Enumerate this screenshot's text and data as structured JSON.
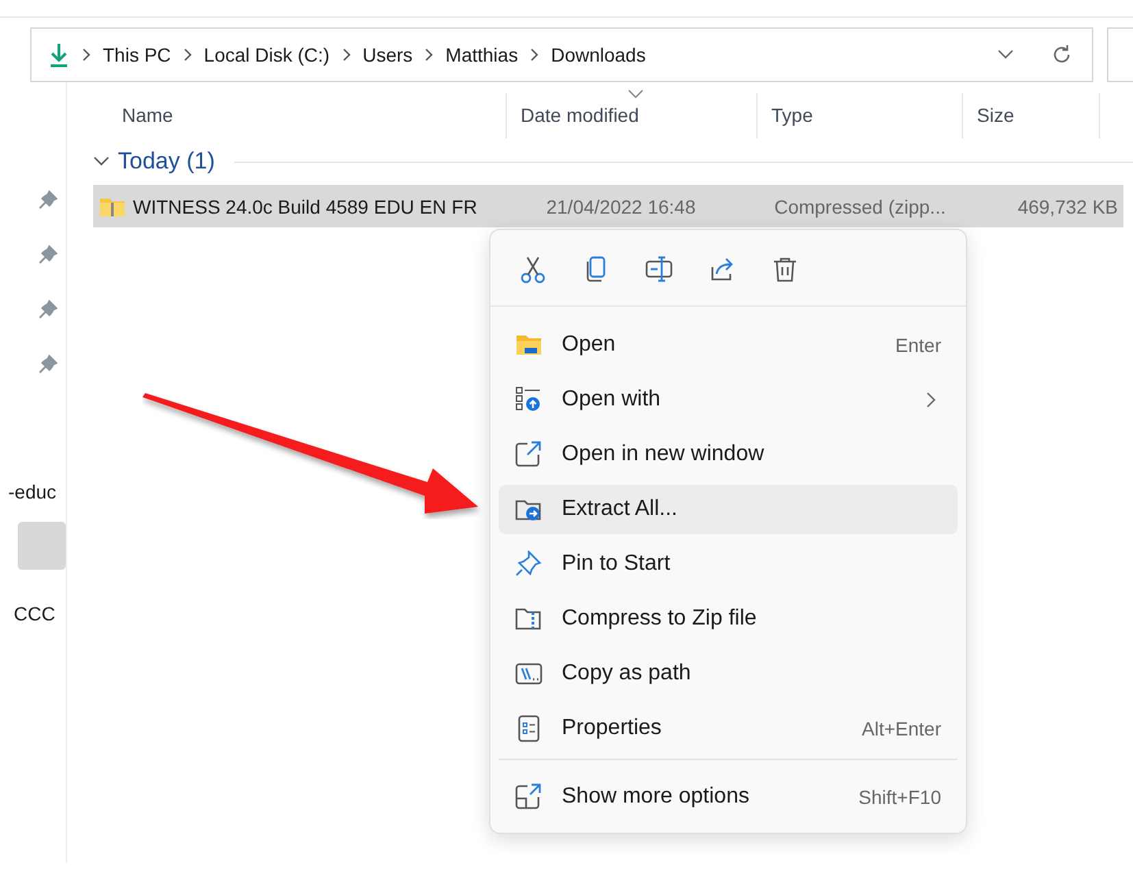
{
  "breadcrumb": [
    "This PC",
    "Local Disk (C:)",
    "Users",
    "Matthias",
    "Downloads"
  ],
  "columns": [
    {
      "label": "Name",
      "sorted": false
    },
    {
      "label": "Date modified",
      "sorted": true
    },
    {
      "label": "Type",
      "sorted": false
    },
    {
      "label": "Size",
      "sorted": false
    }
  ],
  "group": {
    "label": "Today (1)",
    "expanded": true
  },
  "rows": [
    {
      "name": "WITNESS 24.0c Build 4589 EDU EN FR",
      "date": "21/04/2022 16:48",
      "type": "Compressed (zipp...",
      "size": "469,732 KB",
      "selected": true
    }
  ],
  "nav_items": [
    {
      "label": "-educ",
      "selected": false
    },
    {
      "selected": true
    },
    {
      "label": "CCC",
      "selected": false
    }
  ],
  "context_menu": {
    "sections": [
      [
        {
          "label": "Open",
          "shortcut": "Enter",
          "submenu": false,
          "selected": false
        },
        {
          "label": "Open with",
          "submenu": true,
          "selected": false
        },
        {
          "label": "Open in new window",
          "submenu": false,
          "selected": false
        },
        {
          "label": "Extract All...",
          "submenu": false,
          "selected": true
        },
        {
          "label": "Pin to Start",
          "submenu": false,
          "selected": false
        },
        {
          "label": "Compress to Zip file",
          "submenu": false,
          "selected": false
        },
        {
          "label": "Copy as path",
          "submenu": false,
          "selected": false
        },
        {
          "label": "Properties",
          "shortcut": "Alt+Enter",
          "submenu": false,
          "selected": false
        }
      ],
      [
        {
          "label": "Show more options",
          "shortcut": "Shift+F10",
          "submenu": false,
          "selected": false
        }
      ]
    ]
  }
}
